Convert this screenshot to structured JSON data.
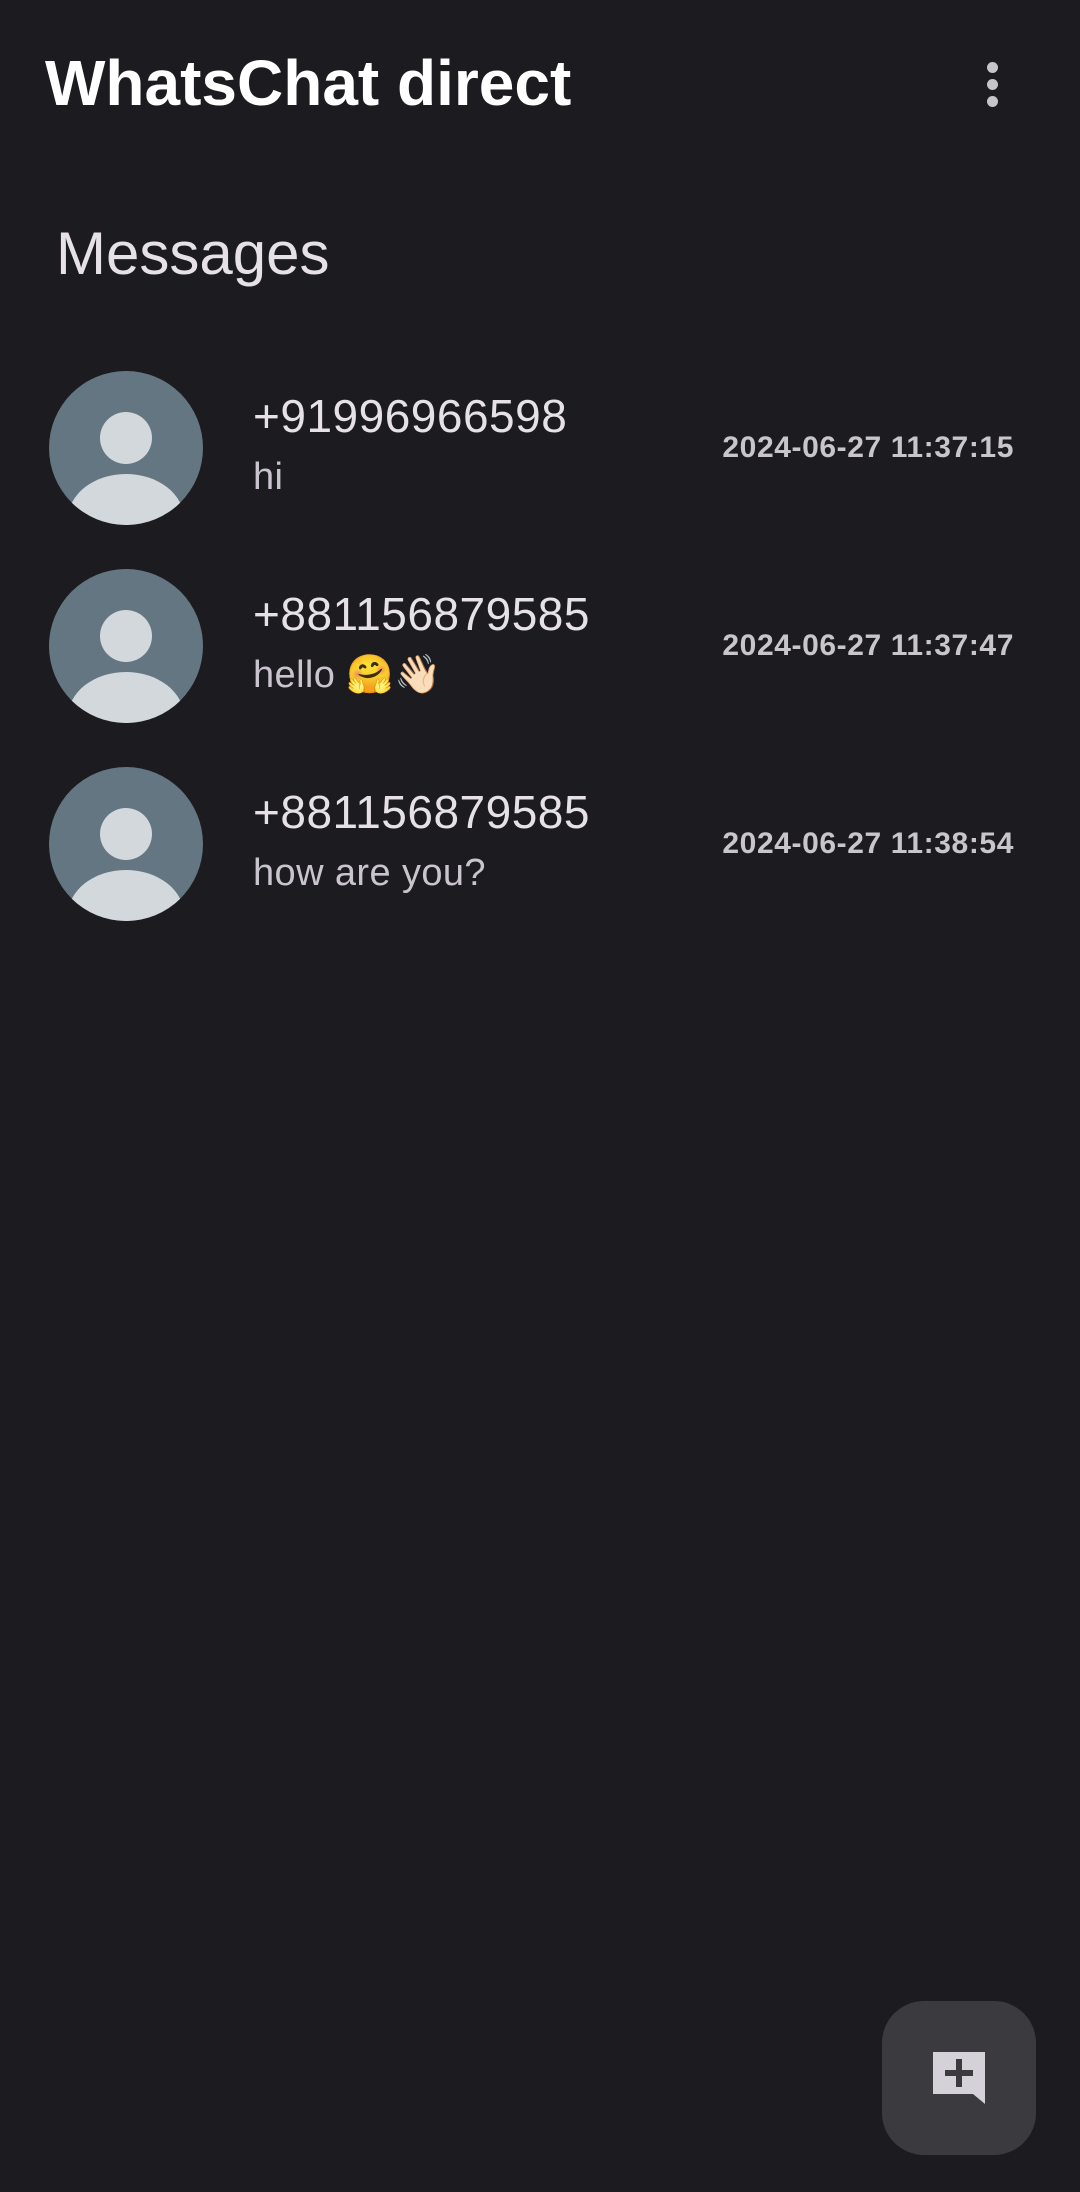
{
  "app_bar": {
    "title": "WhatsChat direct",
    "menu_icon": "more-vert-icon"
  },
  "section": {
    "title": "Messages"
  },
  "conversations": [
    {
      "contact": "+91996966598",
      "preview": "hi",
      "timestamp": "2024-06-27 11:37:15",
      "avatar_icon": "person-icon"
    },
    {
      "contact": "+881156879585",
      "preview": "hello 🤗👋🏻",
      "timestamp": "2024-06-27 11:37:47",
      "avatar_icon": "person-icon"
    },
    {
      "contact": "+881156879585",
      "preview": "how are you?",
      "timestamp": "2024-06-27 11:38:54",
      "avatar_icon": "person-icon"
    }
  ],
  "fab": {
    "icon": "add-comment-icon"
  },
  "colors": {
    "background": "#1c1b20",
    "avatar_bg": "#647682",
    "avatar_fg": "#d3d8dc",
    "fab_bg": "#3b3a3f",
    "fab_icon": "#d4d2d8"
  }
}
